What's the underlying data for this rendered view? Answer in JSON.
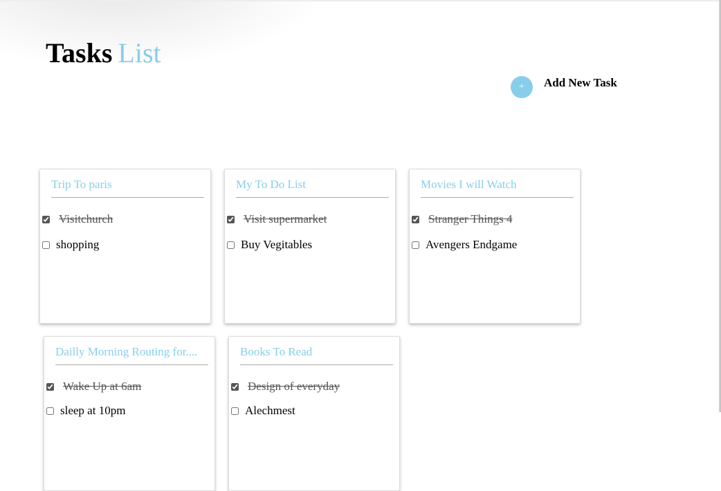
{
  "header": {
    "title_main": "Tasks",
    "title_accent": "List"
  },
  "add_task": {
    "icon": "+",
    "label": "Add New Task"
  },
  "colors": {
    "accent": "#87ceeb",
    "card_border": "#dddddd",
    "divider": "#aaaaaa",
    "done_text": "#555555"
  },
  "lists": [
    {
      "title": "Trip To paris",
      "tasks": [
        {
          "text": "Visitchurch",
          "done": true
        },
        {
          "text": "shopping",
          "done": false
        }
      ]
    },
    {
      "title": "My To Do List",
      "tasks": [
        {
          "text": "Visit supermarket",
          "done": true
        },
        {
          "text": "Buy Vegitables",
          "done": false
        }
      ]
    },
    {
      "title": "Movies I will Watch",
      "tasks": [
        {
          "text": "Stranger Things 4",
          "done": true
        },
        {
          "text": "Avengers Endgame",
          "done": false
        }
      ]
    },
    {
      "title": "Dailly Morning Routing for....",
      "tasks": [
        {
          "text": "Wake Up at 6am",
          "done": true
        },
        {
          "text": "sleep at 10pm",
          "done": false
        }
      ]
    },
    {
      "title": "Books To Read",
      "tasks": [
        {
          "text": "Design of everyday",
          "done": true
        },
        {
          "text": "Alechmest",
          "done": false
        }
      ]
    }
  ]
}
